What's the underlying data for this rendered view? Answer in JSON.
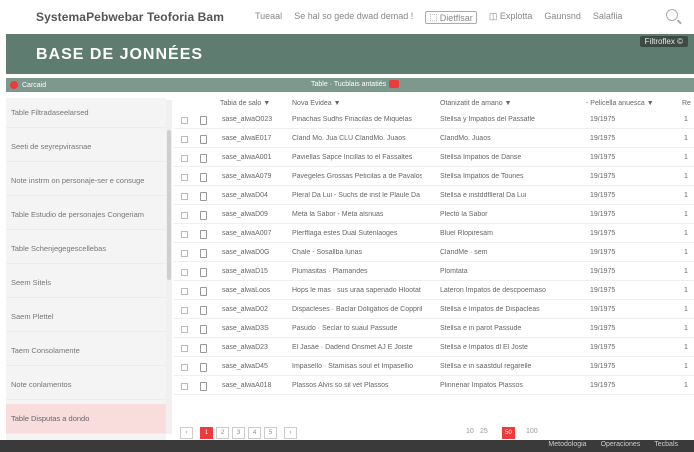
{
  "topnav": {
    "brand": "SystemaPebwebar Teoforia Bam",
    "links": [
      "Tueaal",
      "Se hal so gede dwad demad !",
      "Dietflsar",
      "Explotta",
      "Gaunsnd",
      "Salaflia"
    ],
    "search_icon": "search-icon"
  },
  "banner": {
    "title": "BASE DE JONNÉES",
    "button_label": "Filtroflex ©"
  },
  "strip": {
    "left_label": "Carcaid",
    "center_label": "Table · Tucblais antatiés"
  },
  "sidebar": {
    "items": [
      "Table Filtradaseelarsed",
      "Seeti de seyrepvirasnae",
      "Note instrm on personaje-ser e consuge",
      "Table Estudio de personajes Congeriam",
      "Table Schenjegegescellebas",
      "Seem Sitels",
      "Saem Plettel",
      "Taem Consolamente",
      "Note conlamentos",
      "Table Disputas a dondo"
    ]
  },
  "table": {
    "headers": [
      "Tabia de salo ▼",
      "Nova Evidea ▼",
      "Otanizatit de amano ▼",
      "- Pelicella anuesca ▼",
      "Re"
    ],
    "rows": [
      {
        "id": "sase_alwaO023",
        "title": "Pinachas Sudhs Finacilas de Miquelas",
        "org": "Stellsa y Impatios del Passafle",
        "date": "19/1975",
        "x": "1"
      },
      {
        "id": "sase_alwaE017",
        "title": "Cland Mo. Jua CLU ClandMo. Juaos",
        "org": "ClandMo. Juaos",
        "date": "19/1975",
        "x": "1"
      },
      {
        "id": "sase_alwaA001",
        "title": "Paviellas Sapce Incillas to el Fassaltes",
        "org": "Stellsa Impatios de Danse",
        "date": "19/1975",
        "x": "1"
      },
      {
        "id": "sase_alwaA079",
        "title": "Pavegeles Grossas Peticilas a de Pavalos",
        "org": "Stellsa Impatios de Tounes",
        "date": "19/1975",
        "x": "1"
      },
      {
        "id": "sase_alwaD04",
        "title": "Pleral Da Lui - Suchs de inst le Plaule Da Lau",
        "org": "Stellsa e instddflleral Da Lui",
        "date": "19/1975",
        "x": "1"
      },
      {
        "id": "sase_alwaD09",
        "title": "Meta la Sabor - Meta alsnuas",
        "org": "Plecto la Sabor",
        "date": "19/1975",
        "x": "1"
      },
      {
        "id": "sase_alwaA007",
        "title": "Plerfflaga estes Dual Sutenlaoges",
        "org": "Bluel Rlopiresam",
        "date": "19/1975",
        "x": "1"
      },
      {
        "id": "sase_alwaD0G",
        "title": "Chale - Sosallba lunas",
        "org": "ClandMe · sem",
        "date": "19/1975",
        "x": "1"
      },
      {
        "id": "sase_alwaD15",
        "title": "Plumasitas · Plamandes",
        "org": "Plomtata",
        "date": "19/1975",
        "x": "1"
      },
      {
        "id": "sase_alwaLoos",
        "title": "Hops le mas · sus uraa sapenado Hlootat Parts",
        "org": "Lateron Impatos de descpoemaso",
        "date": "19/1975",
        "x": "1"
      },
      {
        "id": "sase_alwaD02",
        "title": "Dispacleses · Baclar Doligatios de Copprilises",
        "org": "Stellsa e Impatos de Dispacleas",
        "date": "19/1975",
        "x": "1"
      },
      {
        "id": "sase_alwaD3S",
        "title": "Pasudo · Seclar to suaul Passude",
        "org": "Stellsa e in parot Passude",
        "date": "19/1975",
        "x": "1"
      },
      {
        "id": "sase_alwaD23",
        "title": "El Jasáe · Dadend Onsmet AJ E Joiste",
        "org": "Stellsa e Impatos dl El Joste",
        "date": "19/1975",
        "x": "1"
      },
      {
        "id": "sase_alwaD45",
        "title": "Impasello · Stamisas soul et Impasellio",
        "org": "Stellsa e in saastdul regarelle",
        "date": "19/1975",
        "x": "1"
      },
      {
        "id": "sase_alwaA018",
        "title": "Plassos Alvis so sil vet Plassos",
        "org": "Plinnenar Impatos Plassos",
        "date": "19/1975",
        "x": "1"
      }
    ]
  },
  "pager": {
    "pages": [
      "1",
      "2",
      "3",
      "4",
      "5"
    ],
    "sizes": [
      "10",
      "25",
      "50",
      "100"
    ],
    "active_size": "50"
  },
  "footer": {
    "links": [
      "Metodologia",
      "Operaciones",
      "Tecbals"
    ]
  },
  "colors": {
    "banner": "#5e7d70",
    "strip": "#7d988c",
    "accent": "#ee3a3a",
    "active_sidebar": "#f9dcdc",
    "footer": "#3a3a3a"
  }
}
